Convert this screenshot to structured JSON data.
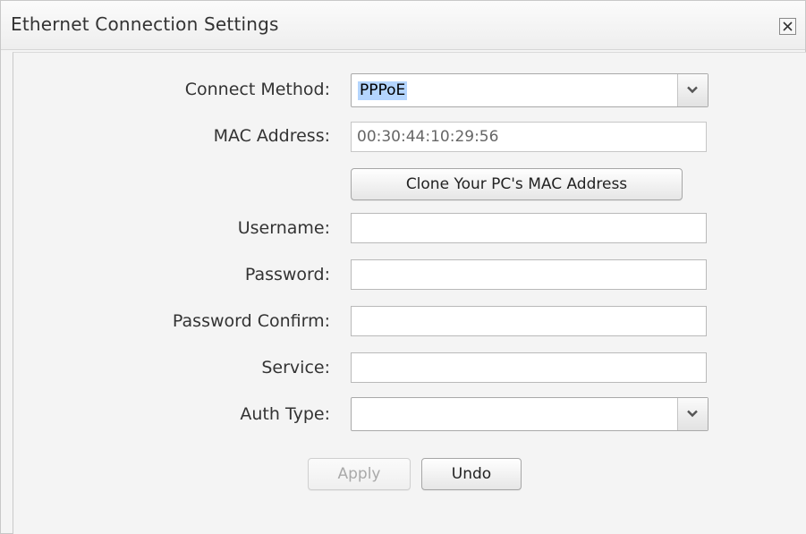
{
  "dialog": {
    "title": "Ethernet Connection Settings",
    "close_icon": "close-icon"
  },
  "form": {
    "connect_method": {
      "label": "Connect Method:",
      "value": "PPPoE"
    },
    "mac_address": {
      "label": "MAC Address:",
      "value": "00:30:44:10:29:56"
    },
    "clone_button": "Clone Your PC's MAC Address",
    "username": {
      "label": "Username:",
      "value": ""
    },
    "password": {
      "label": "Password:",
      "value": ""
    },
    "password_confirm": {
      "label": "Password Confirm:",
      "value": ""
    },
    "service": {
      "label": "Service:",
      "value": ""
    },
    "auth_type": {
      "label": "Auth Type:",
      "value": ""
    }
  },
  "actions": {
    "apply": "Apply",
    "undo": "Undo"
  },
  "colors": {
    "selection_highlight": "#b4d5fe",
    "panel_background": "#f4f4f4"
  }
}
